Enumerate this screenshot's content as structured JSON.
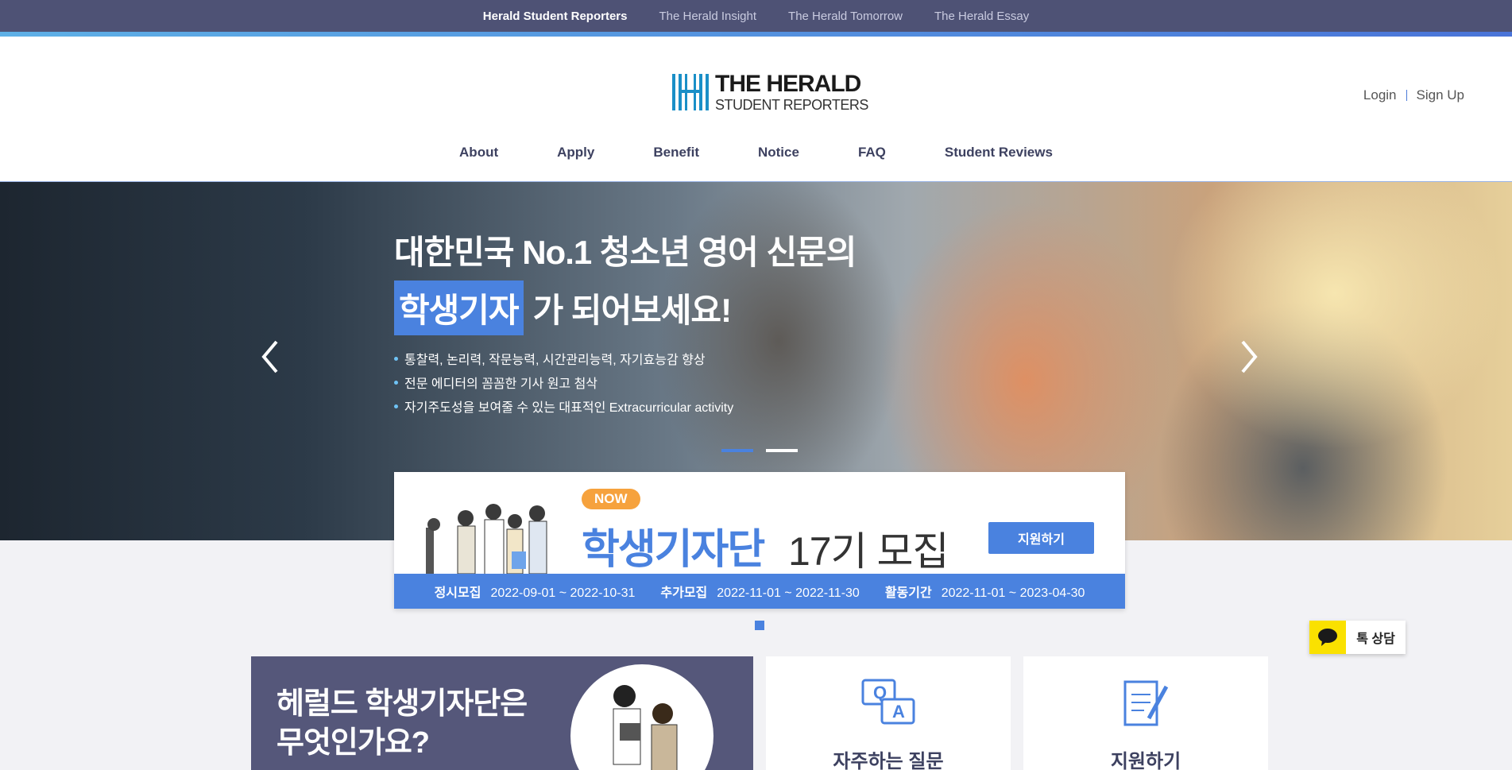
{
  "topbar": {
    "links": [
      {
        "label": "Herald Student Reporters"
      },
      {
        "label": "The Herald Insight"
      },
      {
        "label": "The Herald Tomorrow"
      },
      {
        "label": "The Herald Essay"
      }
    ]
  },
  "header": {
    "logo_line1": "THE HERALD",
    "logo_line2": "STUDENT REPORTERS",
    "login": "Login",
    "signup": "Sign Up"
  },
  "nav": {
    "items": [
      {
        "label": "About"
      },
      {
        "label": "Apply"
      },
      {
        "label": "Benefit"
      },
      {
        "label": "Notice"
      },
      {
        "label": "FAQ"
      },
      {
        "label": "Student Reviews"
      }
    ]
  },
  "hero": {
    "title_line1": "대한민국 No.1 청소년 영어 신문의",
    "title_highlight": "학생기자",
    "title_line2_rest": "가 되어보세요!",
    "bullets": [
      "통찰력, 논리력, 작문능력, 시간관리능력, 자기효능감 향상",
      "전문 에디터의 꼼꼼한 기사 원고 첨삭",
      "자기주도성을 보여줄 수 있는 대표적인 Extracurricular activity"
    ],
    "slide_count": 2,
    "active_slide": 1
  },
  "recruit": {
    "badge": "NOW",
    "title": "학생기자단",
    "subtitle": "17기 모집",
    "apply_button": "지원하기",
    "periods": [
      {
        "label": "정시모집",
        "value": "2022-09-01 ~ 2022-10-31"
      },
      {
        "label": "추가모집",
        "value": "2022-11-01 ~ 2022-11-30"
      },
      {
        "label": "활동기간",
        "value": "2022-11-01 ~ 2023-04-30"
      }
    ]
  },
  "chat": {
    "label": "톡 상담"
  },
  "cards": {
    "about_line1": "헤럴드 학생기자단은",
    "about_line2": "무엇인가요?",
    "faq_label": "자주하는 질문",
    "apply_label": "지원하기"
  },
  "colors": {
    "accent": "#4a82df",
    "topbar": "#4e5275",
    "badge": "#f6a23d",
    "kakao": "#fae100"
  }
}
